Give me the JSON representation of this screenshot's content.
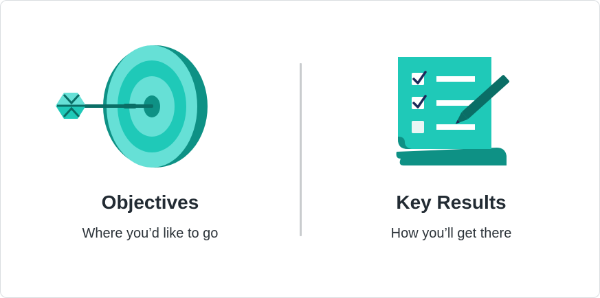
{
  "colors": {
    "teal_light": "#66e0d6",
    "teal_mid": "#1fc9b8",
    "teal_dark": "#0e9185",
    "teal_darker": "#0a6e66",
    "navy": "#1d2a5a",
    "text_dark": "#222b33",
    "divider": "#c9ccce"
  },
  "objectives": {
    "title": "Objectives",
    "subtitle": "Where you’d like to go",
    "icon": "dartboard-icon"
  },
  "key_results": {
    "title": "Key Results",
    "subtitle": "How you’ll get there",
    "icon": "checklist-pencil-icon"
  }
}
